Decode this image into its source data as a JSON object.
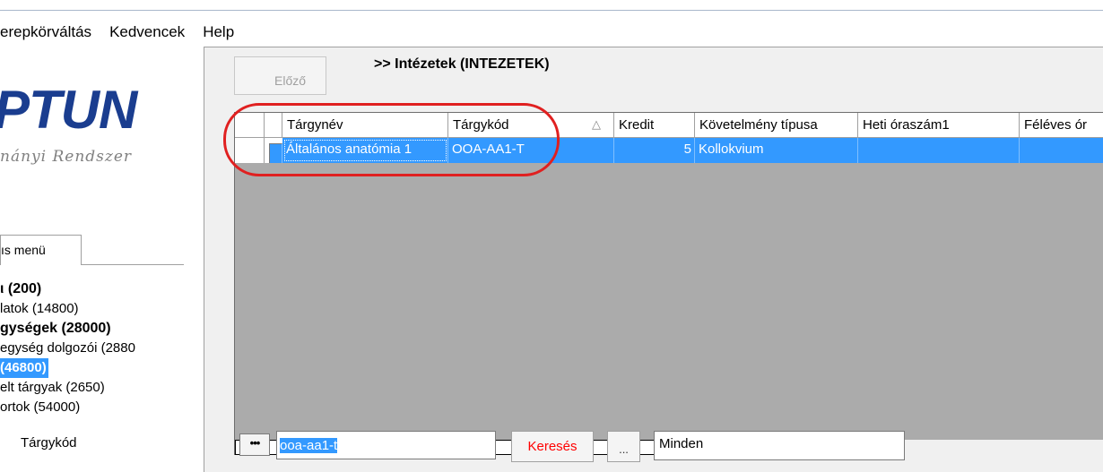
{
  "menu": {
    "items": [
      "erepkörváltás",
      "Kedvencek",
      "Help"
    ]
  },
  "left": {
    "logo_text": "PTUN",
    "logo_subtitle": "nányi Rendszer",
    "menu_tab": "ıs menü",
    "items": [
      {
        "label": "ι (200)",
        "bold": true
      },
      {
        "label": "latok (14800)",
        "bold": false
      },
      {
        "label": "gységek (28000)",
        "bold": true
      },
      {
        "label": "egység dolgozói (2880",
        "bold": false
      },
      {
        "label": "(46800)",
        "selected": true
      },
      {
        "label": "elt tárgyak (2650)",
        "bold": false
      },
      {
        "label": "ortok (54000)",
        "bold": false
      }
    ]
  },
  "main": {
    "prev_button": "Előző",
    "title": ">> Intézetek (INTEZETEK)",
    "grid": {
      "columns": [
        "Tárgynév",
        "Tárgykód",
        "△",
        "Kredit",
        "Követelmény típusa",
        "Heti óraszám1",
        "Féléves ór"
      ],
      "rows": [
        {
          "name": "Általános anatómia 1",
          "code": "OOA-AA1-T",
          "kredit": "5",
          "tipus": "Kollokvium"
        }
      ]
    },
    "search": {
      "label": "Tárgykód",
      "dots_button": "•••",
      "value": "ooa-aa1-t",
      "search_button": "Keresés",
      "more_button": "...",
      "filter_value": "Minden"
    }
  },
  "colors": {
    "selection": "#3399ff",
    "annotation": "#e02020",
    "logo": "#1a3d8f"
  }
}
